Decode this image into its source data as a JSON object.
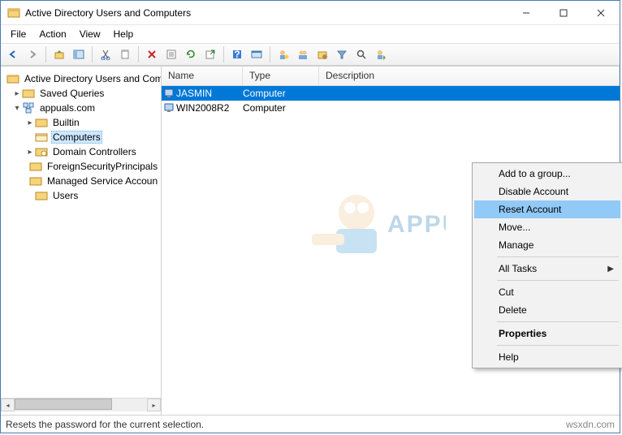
{
  "window": {
    "title": "Active Directory Users and Computers"
  },
  "menubar": {
    "items": [
      "File",
      "Action",
      "View",
      "Help"
    ]
  },
  "tree": {
    "root": "Active Directory Users and Com",
    "nodes": [
      {
        "label": "Saved Queries",
        "kind": "folder-query"
      },
      {
        "label": "appuals.com",
        "kind": "domain",
        "children": [
          {
            "label": "Builtin",
            "kind": "folder"
          },
          {
            "label": "Computers",
            "kind": "folder",
            "selected": true
          },
          {
            "label": "Domain Controllers",
            "kind": "ou"
          },
          {
            "label": "ForeignSecurityPrincipals",
            "kind": "folder"
          },
          {
            "label": "Managed Service Accoun",
            "kind": "folder"
          },
          {
            "label": "Users",
            "kind": "folder"
          }
        ]
      }
    ]
  },
  "list": {
    "columns": {
      "name": "Name",
      "type": "Type",
      "desc": "Description"
    },
    "rows": [
      {
        "name": "JASMIN",
        "type": "Computer",
        "desc": "",
        "selected": true
      },
      {
        "name": "WIN2008R2",
        "type": "Computer",
        "desc": ""
      }
    ]
  },
  "context_menu": {
    "items": [
      {
        "label": "Add to a group..."
      },
      {
        "label": "Disable Account"
      },
      {
        "label": "Reset Account",
        "hover": true
      },
      {
        "label": "Move..."
      },
      {
        "label": "Manage"
      },
      {
        "sep": true
      },
      {
        "label": "All Tasks",
        "submenu": true
      },
      {
        "sep": true
      },
      {
        "label": "Cut"
      },
      {
        "label": "Delete"
      },
      {
        "sep": true
      },
      {
        "label": "Properties",
        "bold": true
      },
      {
        "sep": true
      },
      {
        "label": "Help"
      }
    ]
  },
  "statusbar": {
    "text": "Resets the password for the current selection.",
    "brand": "wsxdn.com"
  },
  "watermark": {
    "text": "APPUALS"
  },
  "toolbar_icons": [
    "back-arrow-icon",
    "forward-arrow-icon",
    "sep",
    "up-icon",
    "show-pane-icon",
    "sep",
    "cut-icon",
    "copy-icon",
    "sep",
    "delete-icon",
    "properties-icon",
    "refresh-icon",
    "export-icon",
    "sep",
    "help-icon",
    "console-icon",
    "sep",
    "user-add-1-icon",
    "user-add-2-icon",
    "user-folder-icon",
    "filter-icon",
    "find-icon",
    "user-query-icon"
  ]
}
